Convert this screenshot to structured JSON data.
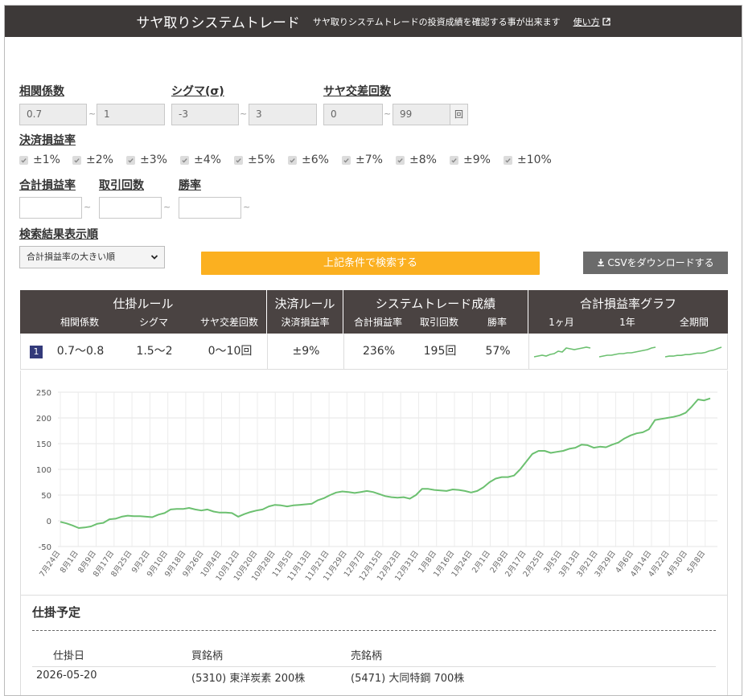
{
  "header": {
    "title": "サヤ取りシステムトレード",
    "subtitle": "サヤ取りシステムトレードの投資成績を確認する事が出来ます",
    "howto": "使い方"
  },
  "form": {
    "correlation": {
      "label": "相関係数",
      "from": "0.7",
      "to": "1"
    },
    "sigma": {
      "label": "シグマ(σ)",
      "from": "-3",
      "to": "3"
    },
    "crosses": {
      "label": "サヤ交差回数",
      "from": "0",
      "to": "99",
      "unit": "回"
    },
    "settlement": {
      "label": "決済損益率",
      "options": [
        "±1%",
        "±2%",
        "±3%",
        "±4%",
        "±5%",
        "±6%",
        "±7%",
        "±8%",
        "±9%",
        "±10%"
      ]
    },
    "total_pl": {
      "label": "合計損益率"
    },
    "trades": {
      "label": "取引回数"
    },
    "winrate": {
      "label": "勝率"
    },
    "tilde": "~",
    "sort": {
      "label": "検索結果表示順",
      "selected": "合計損益率の大きい順"
    },
    "search_button": "上記条件で検索する",
    "csv_button": "CSVをダウンロードする"
  },
  "table": {
    "groups": {
      "entry": "仕掛ルール",
      "exit": "決済ルール",
      "result": "システムトレード成績",
      "graph": "合計損益率グラフ"
    },
    "subheaders": {
      "correlation": "相関係数",
      "sigma": "シグマ",
      "crosses": "サヤ交差回数",
      "settle": "決済損益率",
      "total": "合計損益率",
      "trades": "取引回数",
      "winrate": "勝率",
      "m1": "1ヶ月",
      "y1": "1年",
      "all": "全期間"
    },
    "row": {
      "rank": "1",
      "correlation": "0.7～0.8",
      "sigma": "1.5～2",
      "crosses": "0～10回",
      "settle": "±9%",
      "total": "236%",
      "trades": "195回",
      "winrate": "57%"
    }
  },
  "chart_data": {
    "type": "line",
    "ylim": [
      -50,
      250
    ],
    "yticks": [
      250,
      200,
      150,
      100,
      50,
      0,
      -50
    ],
    "x_tick_labels": [
      "7月24日",
      "8月1日",
      "8月9日",
      "8月17日",
      "8月25日",
      "9月2日",
      "9月10日",
      "9月18日",
      "9月26日",
      "10月4日",
      "10月12日",
      "10月20日",
      "10月28日",
      "11月5日",
      "11月13日",
      "11月21日",
      "11月29日",
      "12月7日",
      "12月15日",
      "12月23日",
      "12月31日",
      "1月8日",
      "1月16日",
      "1月24日",
      "2月1日",
      "2月9日",
      "2月17日",
      "2月25日",
      "3月5日",
      "3月13日",
      "3月21日",
      "3月29日",
      "4月6日",
      "4月14日",
      "4月22日",
      "4月30日",
      "5月8日"
    ],
    "grid": true,
    "color": "#6cc070",
    "values": [
      -2,
      -5,
      -9,
      -14,
      -13,
      -11,
      -6,
      -4,
      3,
      4,
      8,
      10,
      9,
      9,
      8,
      7,
      12,
      15,
      22,
      23,
      23,
      25,
      22,
      20,
      22,
      18,
      16,
      16,
      15,
      8,
      13,
      17,
      20,
      22,
      28,
      31,
      30,
      28,
      30,
      31,
      32,
      33,
      40,
      44,
      50,
      55,
      57,
      56,
      54,
      56,
      58,
      56,
      52,
      48,
      46,
      45,
      46,
      43,
      50,
      62,
      62,
      60,
      59,
      58,
      61,
      60,
      58,
      55,
      58,
      65,
      75,
      82,
      85,
      85,
      88,
      100,
      115,
      130,
      136,
      136,
      132,
      134,
      136,
      140,
      142,
      148,
      147,
      142,
      144,
      143,
      148,
      152,
      160,
      166,
      170,
      172,
      178,
      196,
      198,
      200,
      202,
      205,
      210,
      222,
      236,
      234,
      238
    ],
    "thumbs": {
      "m1": [
        1,
        2,
        3,
        2,
        4,
        5,
        8,
        7,
        12,
        11,
        10,
        11,
        12,
        13,
        12
      ],
      "y1": [
        1,
        2,
        3,
        3,
        4,
        5,
        5,
        6,
        6,
        7,
        8,
        9,
        10,
        12,
        13
      ],
      "all": [
        1,
        2,
        2,
        3,
        3,
        4,
        4,
        5,
        6,
        6,
        7,
        9,
        10,
        12,
        14
      ]
    }
  },
  "plan": {
    "title": "仕掛予定",
    "headers": {
      "date": "仕掛日",
      "buy": "買銘柄",
      "sell": "売銘柄"
    },
    "rows": [
      {
        "date": "2026-05-20",
        "buy": "(5310) 東洋炭素 200株",
        "sell": "(5471) 大同特鋼 700株"
      }
    ]
  }
}
